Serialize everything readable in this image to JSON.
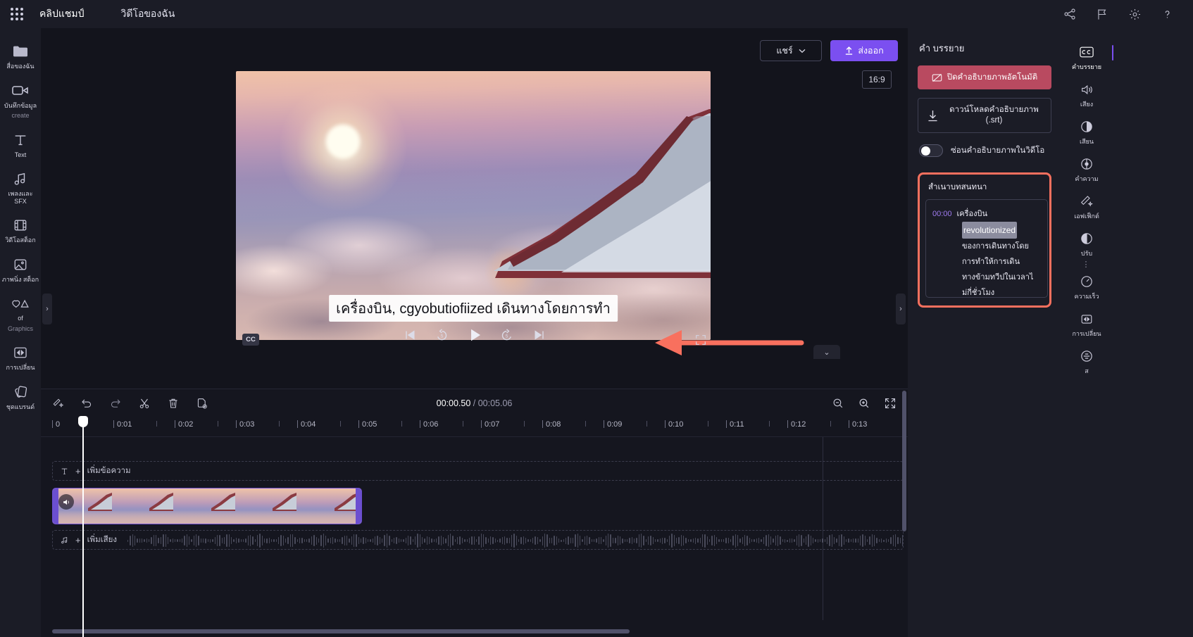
{
  "topbar": {
    "brand": "คลิปแชมป์",
    "my_videos_tab": "วิดีโอของฉัน",
    "icons": [
      "share-network-icon",
      "flag-icon",
      "settings-gear-icon",
      "help-question-icon"
    ]
  },
  "left_rail": [
    {
      "icon": "folder-icon",
      "label": "สื่อของฉัน",
      "sublabel": ""
    },
    {
      "icon": "video-camera-icon",
      "label": "บันทึกข้อมูล",
      "sublabel": "create"
    },
    {
      "icon": "text-T-icon",
      "label": "Text",
      "sublabel": ""
    },
    {
      "icon": "music-note-icon",
      "label": "เพลงและ SFX",
      "sublabel": ""
    },
    {
      "icon": "filmstrip-icon",
      "label": "วิดีโอสต็อก",
      "sublabel": ""
    },
    {
      "icon": "image-icon",
      "label": "ภาพนิ่ง สต็อก",
      "sublabel": ""
    },
    {
      "icon": "shapes-icon",
      "label": "of",
      "sublabel": "Graphics"
    },
    {
      "icon": "transition-icon",
      "label": "การเปลี่ยน",
      "sublabel": ""
    },
    {
      "icon": "layers-icon",
      "label": "ชุดแบรนด์",
      "sublabel": ""
    }
  ],
  "preview": {
    "share_label": "แชร์",
    "export_label": "ส่งออก",
    "aspect_ratio": "16:9",
    "caption_overlay": "เครื่องบิน, cgyobutiofiized เดินทางโดยการทำ",
    "cc_label": "CC",
    "annotation_color": "#f8705e"
  },
  "timeline": {
    "current_time": "00:00.50",
    "separator": " / ",
    "total_time": "00:05.06",
    "tools": [
      "magic-wand-icon",
      "undo-icon",
      "redo-icon",
      "scissors-icon",
      "trash-icon",
      "duplicate-icon"
    ],
    "zoom_tools": [
      "zoom-out-icon",
      "zoom-in-icon",
      "fit-to-screen-icon"
    ],
    "ruler_ticks": [
      "0",
      "0:01",
      "0:02",
      "0:03",
      "0:04",
      "0:05",
      "0:06",
      "0:07",
      "0:08",
      "0:09",
      "0:10",
      "0:11",
      "0:12",
      "0:13"
    ],
    "text_track_label": "เพิ่มข้อความ",
    "audio_track_label": "เพิ่มเสียง"
  },
  "captions_panel": {
    "title": "คำ บรรยาย",
    "disable_button": "ปิดคำอธิบายภาพอัตโนมัติ",
    "download_button_line1": "ดาวน์โหลดคำอธิบายภาพ",
    "download_button_line2": "(.srt)",
    "hide_toggle_label": "ซ่อนคำอธิบายภาพในวิดีโอ",
    "transcript_title": "สำเนาบทสนทนา",
    "transcript": {
      "timestamp": "00:00",
      "lines": [
        {
          "text": "เครื่องบิน",
          "selected": false
        },
        {
          "text": "revolutionized",
          "selected": true
        },
        {
          "text": "ของการเดินทางโดย",
          "selected": false
        },
        {
          "text": "การทำให้การเดิน",
          "selected": false
        },
        {
          "text": "ทางข้ามทวีปในเวลาไ",
          "selected": false
        },
        {
          "text": "ม่กี่ชั่วโมง",
          "selected": false
        }
      ]
    }
  },
  "far_rail": [
    {
      "icon": "cc-icon",
      "label": "คำบรรยาย",
      "active": true
    },
    {
      "icon": "speaker-icon",
      "label": "เสียง",
      "active": false
    },
    {
      "icon": "contrast-icon",
      "label": "เสียน",
      "active": false
    },
    {
      "icon": "color-wheel-icon",
      "label": "คำความ",
      "active": false
    },
    {
      "icon": "effects-sparkle-icon",
      "label": "เอฟเฟ็กต์",
      "active": false
    },
    {
      "icon": "adjust-icon",
      "label": "ปรับ",
      "active": false
    },
    {
      "icon": "speed-gauge-icon",
      "label": "ความเร็ว",
      "active": false
    },
    {
      "icon": "fade-icon",
      "label": "การเปลี่ยน",
      "active": false
    },
    {
      "icon": "filters-icon",
      "label": "ส",
      "active": false
    }
  ]
}
